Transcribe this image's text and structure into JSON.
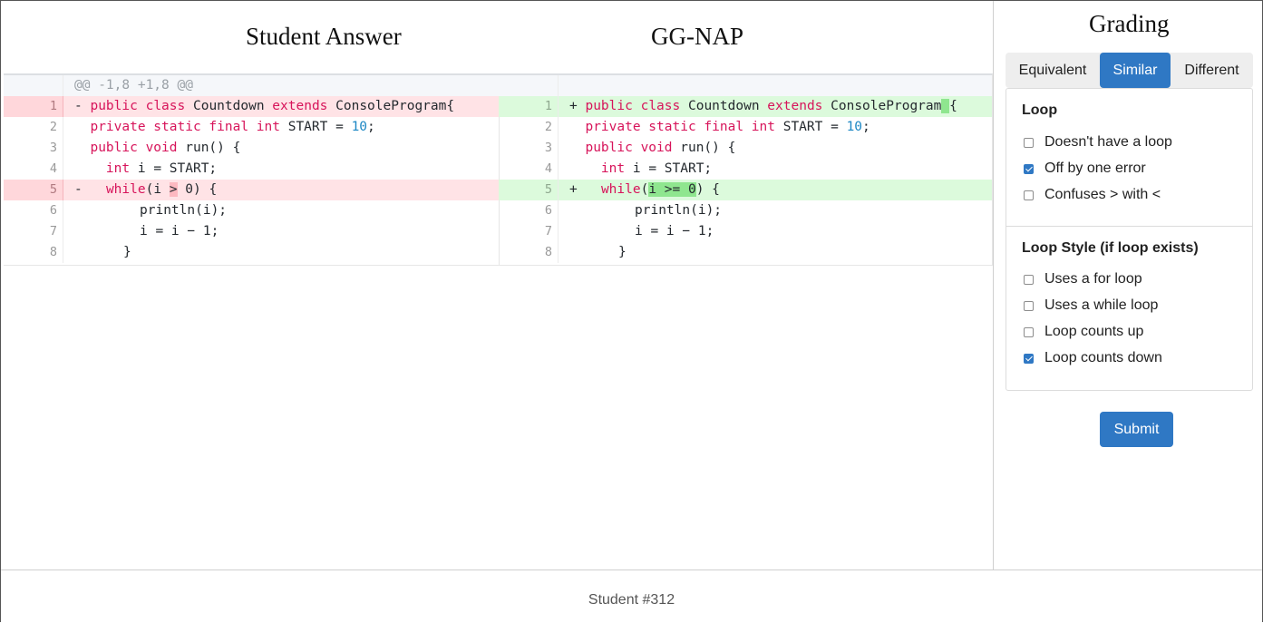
{
  "diff": {
    "left_title": "Student Answer",
    "right_title": "GG-NAP",
    "hunk_header": "@@ -1,8 +1,8 @@",
    "line_numbers": [
      "1",
      "2",
      "3",
      "4",
      "5",
      "6",
      "7",
      "8"
    ],
    "left": {
      "line1": {
        "marker": "-",
        "kw1": "public",
        "kw2": "class",
        "t1": "Countdown",
        "kw3": "extends",
        "t2": "ConsoleProgram{"
      },
      "line2": {
        "kw": "private static final int",
        "t": "START =",
        "num": "10",
        "end": ";"
      },
      "line3": {
        "kw": "public void",
        "t": "run() {"
      },
      "line4": {
        "kw": "int",
        "t": "i = START;"
      },
      "line5": {
        "marker": "-",
        "kw": "while",
        "t1": "(i ",
        "hl": ">",
        "t2": " 0) {"
      },
      "line6": "println(i);",
      "line7": "i = i − 1;",
      "line8": "}"
    },
    "right": {
      "line1": {
        "marker": "+",
        "kw1": "public",
        "kw2": "class",
        "t1": "Countdown",
        "kw3": "extends",
        "t2": "ConsoleProgram",
        "hl": " ",
        "t3": "{"
      },
      "line2": {
        "kw": "private static final int",
        "t": "START =",
        "num": "10",
        "end": ";"
      },
      "line3": {
        "kw": "public void",
        "t": "run() {"
      },
      "line4": {
        "kw": "int",
        "t": "i = START;"
      },
      "line5": {
        "marker": "+",
        "kw": "while",
        "t1": "(",
        "hl": "i >= 0",
        "t2": ") {"
      },
      "line6": "println(i);",
      "line7": "i = i − 1;",
      "line8": "}"
    }
  },
  "grading": {
    "title": "Grading",
    "tabs": [
      {
        "label": "Equivalent",
        "active": false
      },
      {
        "label": "Similar",
        "active": true
      },
      {
        "label": "Different",
        "active": false
      }
    ],
    "loop": {
      "title": "Loop",
      "options": [
        {
          "label": "Doesn't have a loop",
          "checked": false
        },
        {
          "label": "Off by one error",
          "checked": true
        },
        {
          "label": "Confuses > with <",
          "checked": false
        }
      ]
    },
    "loop_style": {
      "title": "Loop Style (if loop exists)",
      "options": [
        {
          "label": "Uses a for loop",
          "checked": false
        },
        {
          "label": "Uses a while loop",
          "checked": false
        },
        {
          "label": "Loop counts up",
          "checked": false
        },
        {
          "label": "Loop counts down",
          "checked": true
        }
      ]
    },
    "submit_label": "Submit"
  },
  "footer": {
    "student_label": "Student #312"
  },
  "colors": {
    "accent": "#2f78c4",
    "deleted_bg": "#ffe3e6",
    "added_bg": "#dcfadc",
    "keyword": "#d7145a",
    "number": "#1c87c4"
  }
}
